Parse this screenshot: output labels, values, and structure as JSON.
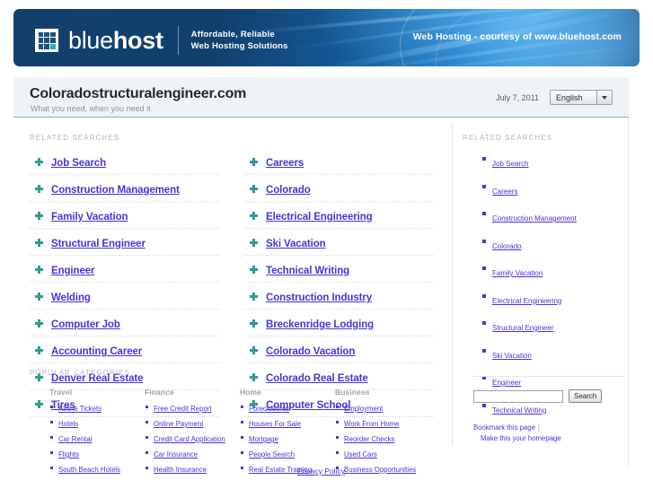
{
  "banner": {
    "logo_text_light": "blue",
    "logo_text_bold": "host",
    "tagline_line1": "Affordable, Reliable",
    "tagline_line2": "Web Hosting Solutions",
    "courtesy": "Web Hosting - courtesy of www.bluehost.com"
  },
  "titlebar": {
    "domain": "Coloradostructuralengineer.com",
    "subtitle": "What you need, when you need it",
    "date": "July 7, 2011",
    "language": "English"
  },
  "main": {
    "related_label": "RELATED SEARCHES",
    "related_left": [
      {
        "label": "Job Search"
      },
      {
        "label": "Construction Management"
      },
      {
        "label": "Family Vacation"
      },
      {
        "label": "Structural Engineer"
      },
      {
        "label": "Engineer"
      },
      {
        "label": "Welding"
      },
      {
        "label": "Computer Job"
      },
      {
        "label": "Accounting Career"
      },
      {
        "label": "Denver Real Estate"
      },
      {
        "label": "Tires"
      }
    ],
    "related_right": [
      {
        "label": "Careers"
      },
      {
        "label": "Colorado"
      },
      {
        "label": "Electrical Engineering"
      },
      {
        "label": "Ski Vacation"
      },
      {
        "label": "Technical Writing"
      },
      {
        "label": "Construction Industry"
      },
      {
        "label": "Breckenridge Lodging"
      },
      {
        "label": "Colorado Vacation"
      },
      {
        "label": "Colorado Real Estate"
      },
      {
        "label": "Computer School"
      }
    ],
    "popular_label": "POPULAR CATEGORIES",
    "categories": [
      {
        "title": "Travel",
        "items": [
          "Airline Tickets",
          "Hotels",
          "Car Rental",
          "Flights",
          "South Beach Hotels"
        ]
      },
      {
        "title": "Finance",
        "items": [
          "Free Credit Report",
          "Online Payment",
          "Credit Card Application",
          "Car Insurance",
          "Health Insurance"
        ]
      },
      {
        "title": "Home",
        "items": [
          "Foreclosures",
          "Houses For Sale",
          "Mortgage",
          "People Search",
          "Real Estate Training"
        ]
      },
      {
        "title": "Business",
        "items": [
          "Employment",
          "Work From Home",
          "Reorder Checks",
          "Used Cars",
          "Business Opportunities"
        ]
      }
    ]
  },
  "sidebar": {
    "related_label": "RELATED SEARCHES",
    "items": [
      {
        "label": "Job Search"
      },
      {
        "label": "Careers"
      },
      {
        "label": "Construction Management"
      },
      {
        "label": "Colorado"
      },
      {
        "label": "Family Vacation"
      },
      {
        "label": "Electrical Engineering"
      },
      {
        "label": "Structural Engineer"
      },
      {
        "label": "Ski Vacation"
      },
      {
        "label": "Engineer"
      },
      {
        "label": "Technical Writing"
      }
    ],
    "search_value": "",
    "search_placeholder": "",
    "search_button": "Search",
    "bookmark_link": "Bookmark this page",
    "homepage_link": "Make this your homepage"
  },
  "footer": {
    "privacy": "Privacy Policy"
  },
  "colors": {
    "link": "#4437d6",
    "banner_dark": "#0f3d6e",
    "banner_light": "#2b90d8",
    "marker_green": "#2f9c8f",
    "titlebar_bg": "#eef3f6"
  }
}
